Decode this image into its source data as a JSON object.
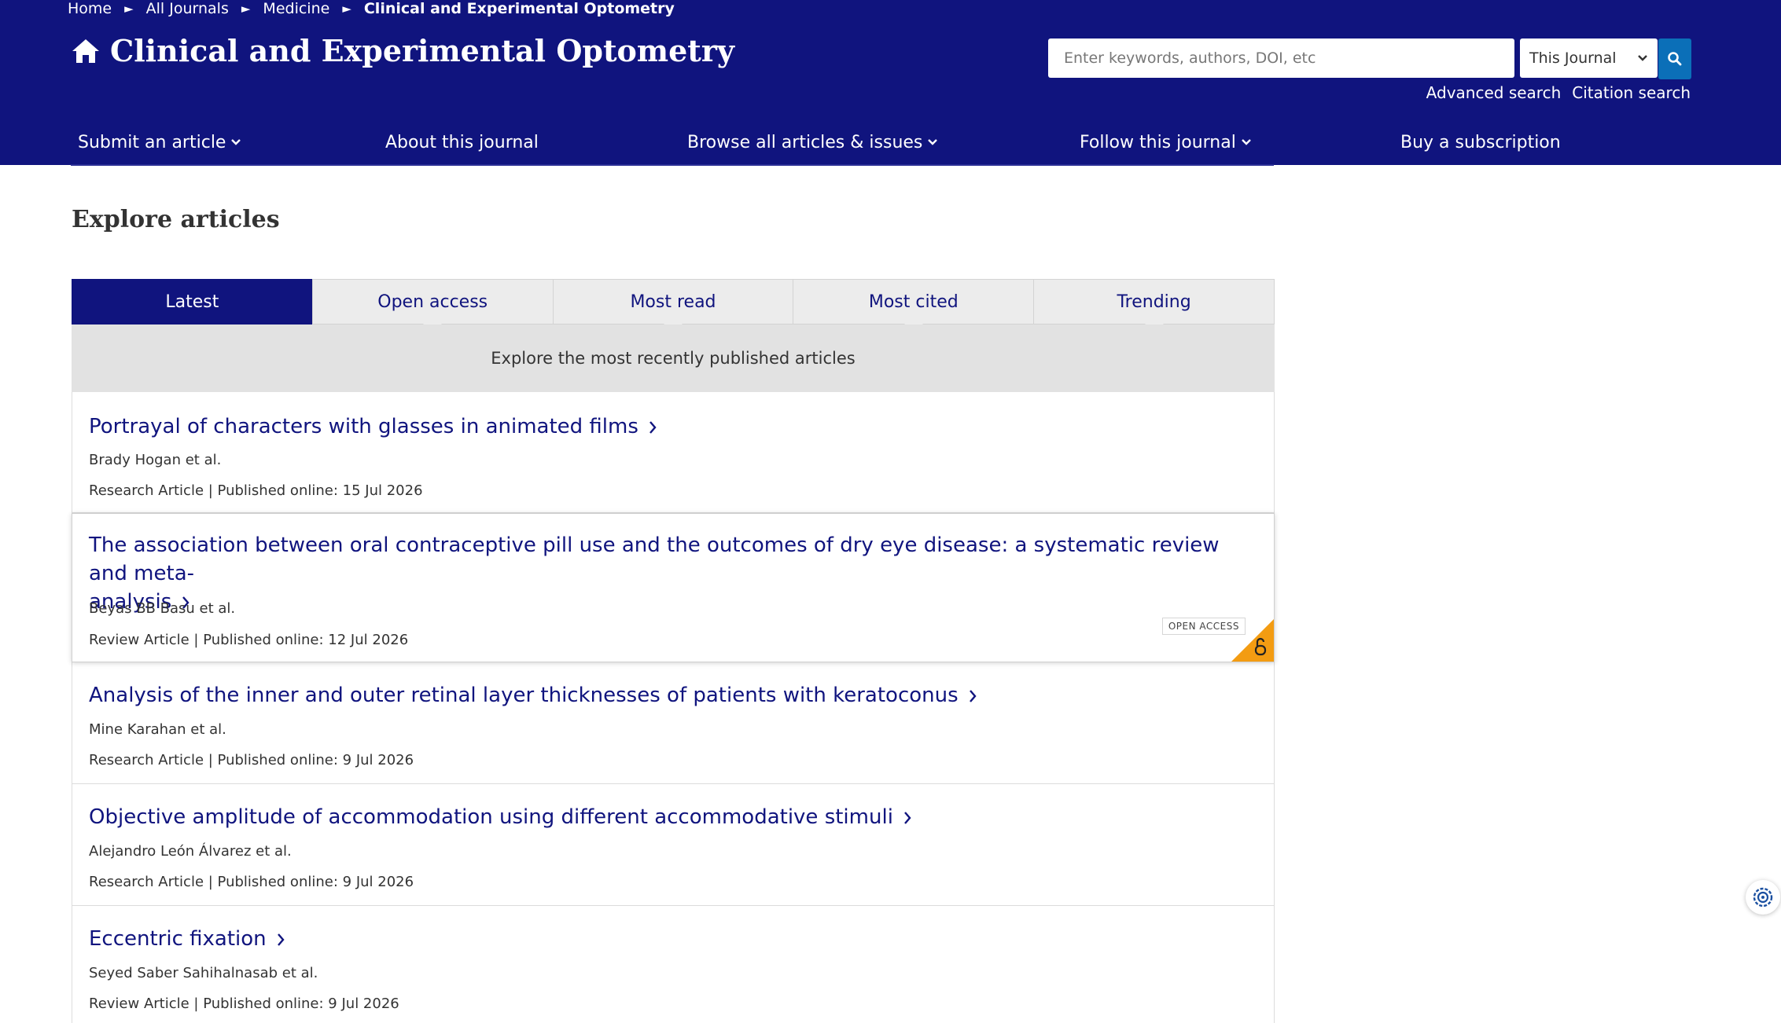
{
  "breadcrumb": {
    "items": [
      "Home",
      "All Journals",
      "Medicine",
      "Clinical and Experimental Optometry"
    ],
    "separator": "►"
  },
  "header": {
    "journal_title": "Clinical and Experimental Optometry",
    "home_icon": "home-icon",
    "bg_color": "#10147e"
  },
  "search": {
    "placeholder": "Enter keywords, authors, DOI, etc",
    "value": "",
    "scope_selected": "This Journal",
    "button_icon": "search-icon",
    "advanced_label": "Advanced search",
    "citation_label": "Citation search"
  },
  "nav": {
    "items": [
      {
        "label": "Submit an article",
        "has_dropdown": true
      },
      {
        "label": "About this journal",
        "has_dropdown": false
      },
      {
        "label": "Browse all articles & issues",
        "has_dropdown": true
      },
      {
        "label": "Follow this journal",
        "has_dropdown": true
      },
      {
        "label": "Buy a subscription",
        "has_dropdown": false
      }
    ]
  },
  "explore": {
    "title": "Explore articles",
    "tabs": [
      "Latest",
      "Open access",
      "Most read",
      "Most cited",
      "Trending"
    ],
    "active_tab": "Latest",
    "description": "Explore the most recently published articles"
  },
  "articles": [
    {
      "title": "Portrayal of characters with glasses in animated films",
      "authors": "Brady Hogan et al.",
      "type": "Research Article",
      "published_label": "Published online:",
      "date": "15 Jul 2026",
      "open_access": false
    },
    {
      "title_line1": "The association between oral contraceptive pill use and the outcomes of dry eye disease: a systematic review and meta-",
      "title_line2": "analysis",
      "authors": "Beyas BB Basu et al.",
      "type": "Review Article",
      "published_label": "Published online:",
      "date": "12 Jul 2026",
      "open_access": true,
      "open_access_label": "OPEN ACCESS"
    },
    {
      "title": "Analysis of the inner and outer retinal layer thicknesses of patients with keratoconus",
      "authors": "Mine Karahan et al.",
      "type": "Research Article",
      "published_label": "Published online:",
      "date": "9 Jul 2026",
      "open_access": false
    },
    {
      "title": "Objective amplitude of accommodation using different accommodative stimuli",
      "authors": "Alejandro León Álvarez et al.",
      "type": "Research Article",
      "published_label": "Published online:",
      "date": "9 Jul 2026",
      "open_access": false
    },
    {
      "title": "Eccentric fixation",
      "authors": "Seyed Saber Sahihalnasab et al.",
      "type": "Review Article",
      "published_label": "Published online:",
      "date": "9 Jul 2026",
      "open_access": false
    }
  ],
  "colors": {
    "brand": "#10147e",
    "link": "#10147e",
    "search_button": "#0b6fb8",
    "open_access": "#f39c12"
  }
}
